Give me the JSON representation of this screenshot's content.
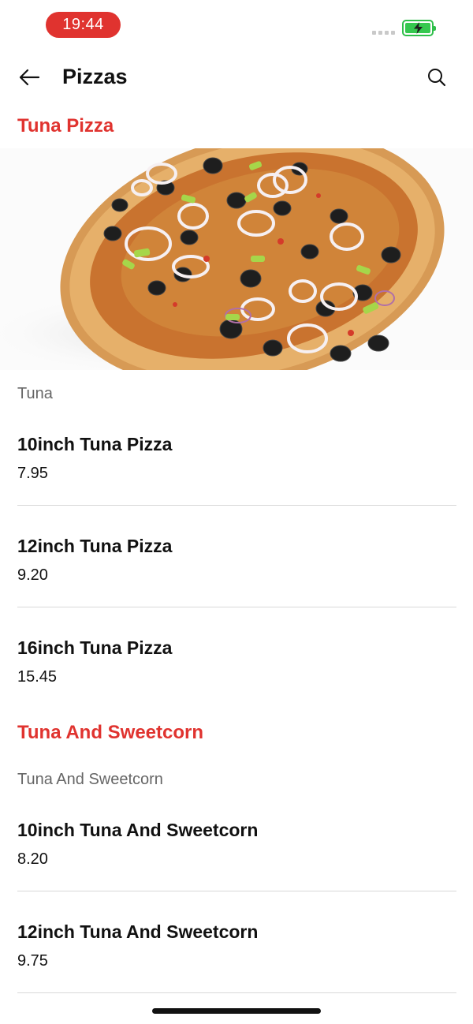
{
  "status_bar": {
    "time": "19:44",
    "accent_color": "#e0332f",
    "battery_color": "#35c84f",
    "battery_state": "charging"
  },
  "header": {
    "title": "Pizzas",
    "back_icon": "arrow-left-icon",
    "search_icon": "search-icon"
  },
  "sections": [
    {
      "title": "Tuna Pizza",
      "description": "Tuna",
      "image": "tuna-pizza-photo",
      "items": [
        {
          "name": "10inch Tuna Pizza",
          "price": "7.95"
        },
        {
          "name": "12inch Tuna Pizza",
          "price": "9.20"
        },
        {
          "name": "16inch Tuna Pizza",
          "price": "15.45"
        }
      ]
    },
    {
      "title": "Tuna And Sweetcorn",
      "description": "Tuna And Sweetcorn",
      "items": [
        {
          "name": "10inch Tuna And Sweetcorn",
          "price": "8.20"
        },
        {
          "name": "12inch Tuna And Sweetcorn",
          "price": "9.75"
        }
      ]
    }
  ],
  "colors": {
    "section_title": "#e0332f",
    "divider": "#d8d8d8"
  }
}
